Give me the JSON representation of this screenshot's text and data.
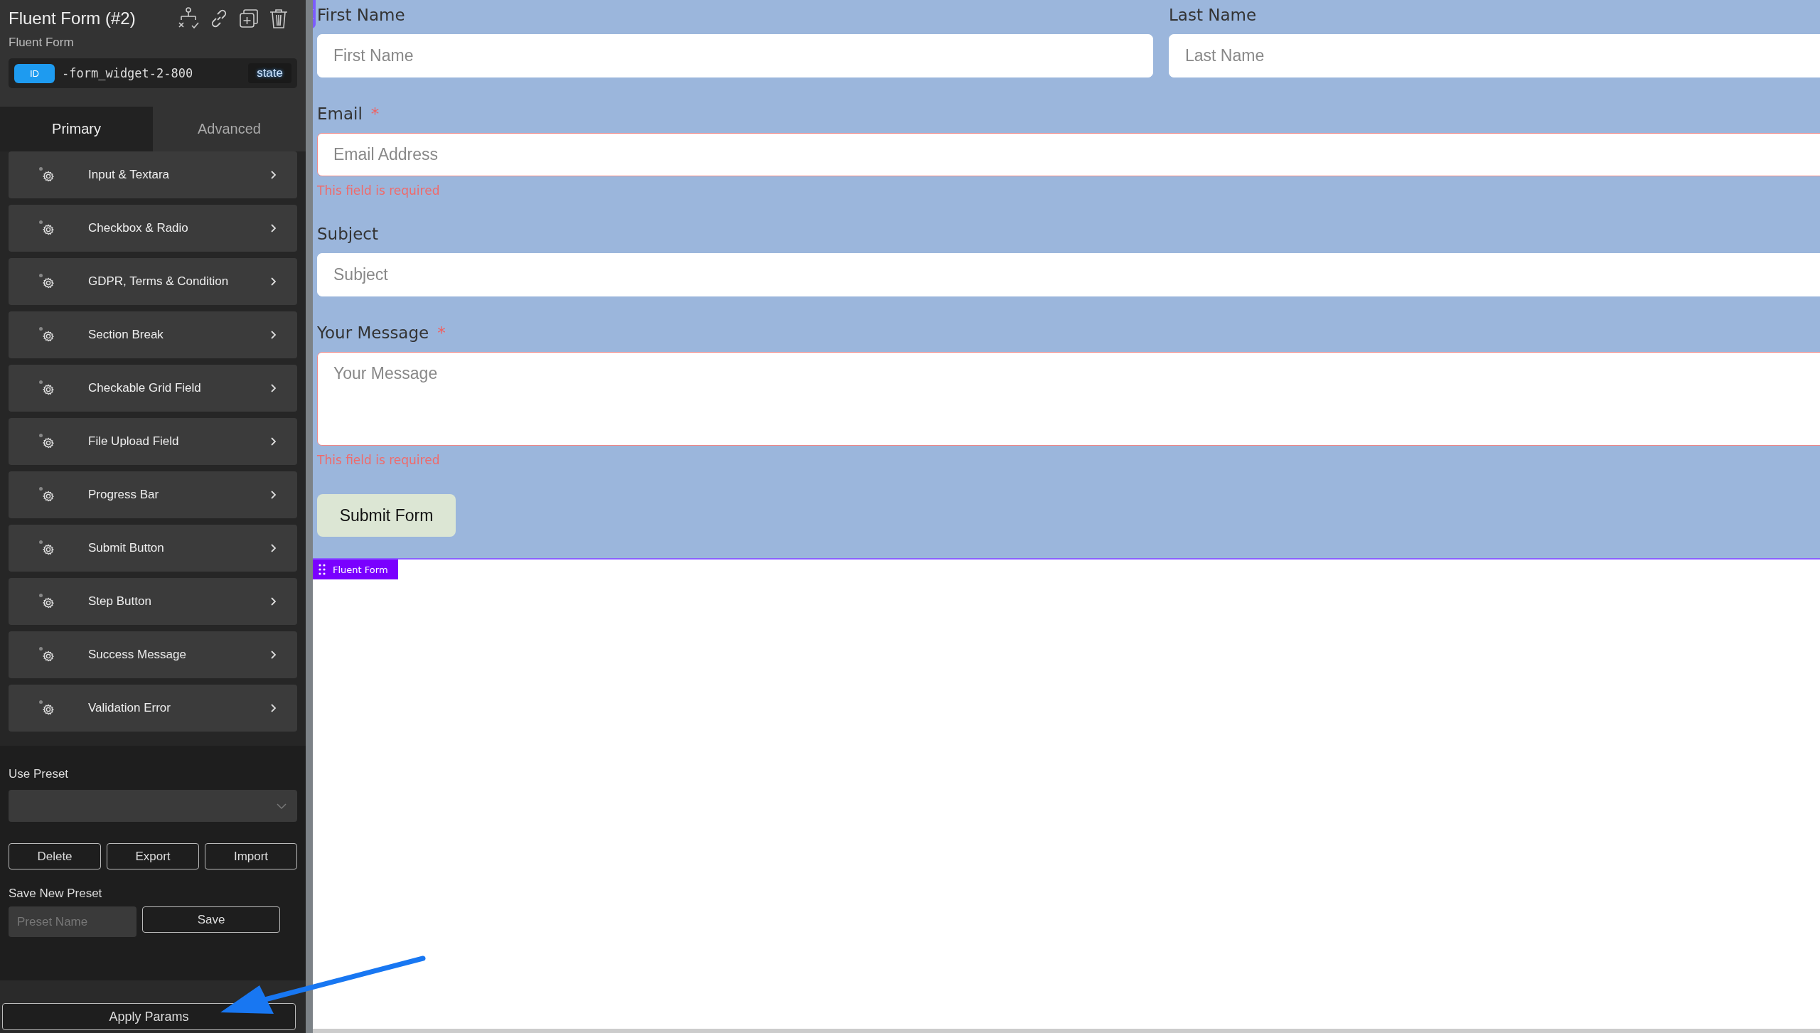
{
  "element": {
    "title": "Fluent Form (#2)",
    "type_label": "Fluent Form",
    "id_badge": "ID",
    "id_value": "-form_widget-2-800",
    "state_badge": "state"
  },
  "tabs": [
    {
      "label": "Primary",
      "selected": true
    },
    {
      "label": "Advanced",
      "selected": false
    }
  ],
  "style_sections": [
    {
      "label": "Input & Textara"
    },
    {
      "label": "Checkbox & Radio"
    },
    {
      "label": "GDPR, Terms & Condition"
    },
    {
      "label": "Section Break"
    },
    {
      "label": "Checkable Grid Field"
    },
    {
      "label": "File Upload Field"
    },
    {
      "label": "Progress Bar"
    },
    {
      "label": "Submit Button"
    },
    {
      "label": "Step Button"
    },
    {
      "label": "Success Message"
    },
    {
      "label": "Validation Error"
    }
  ],
  "presets": {
    "use_label": "Use Preset",
    "buttons": [
      "Delete",
      "Export",
      "Import"
    ],
    "save_label": "Save New Preset",
    "name_placeholder": "Preset Name",
    "save_button": "Save"
  },
  "apply_button": "Apply Params",
  "form": {
    "required_mark": "*",
    "rows": [
      [
        {
          "kind": "text",
          "label": "First Name",
          "placeholder": "First Name",
          "required": false
        },
        {
          "kind": "text",
          "label": "Last Name",
          "placeholder": "Last Name",
          "required": false
        }
      ],
      [
        {
          "kind": "text",
          "label": "Email",
          "placeholder": "Email Address",
          "required": true,
          "error": "This field is required"
        }
      ],
      [
        {
          "kind": "text",
          "label": "Subject",
          "placeholder": "Subject",
          "required": false
        }
      ],
      [
        {
          "kind": "textarea",
          "label": "Your Message",
          "placeholder": "Your Message",
          "required": true,
          "error": "This field is required"
        }
      ]
    ],
    "submit": "Submit Form",
    "badge": "Fluent Form"
  }
}
